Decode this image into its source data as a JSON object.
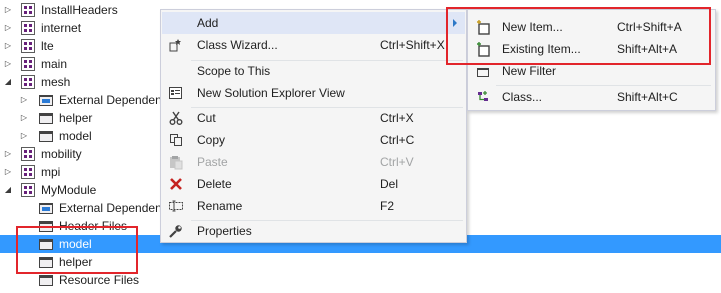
{
  "tree": {
    "items": [
      {
        "label": "InstallHeaders",
        "icon": "module-icon",
        "expander": "collapsed"
      },
      {
        "label": "internet",
        "icon": "module-icon",
        "expander": "collapsed"
      },
      {
        "label": "lte",
        "icon": "module-icon",
        "expander": "collapsed"
      },
      {
        "label": "main",
        "icon": "module-icon",
        "expander": "collapsed"
      },
      {
        "label": "mesh",
        "icon": "module-icon",
        "expander": "expanded"
      },
      {
        "label": "External Dependencies",
        "icon": "external-dependencies-icon",
        "expander": "collapsed"
      },
      {
        "label": "helper",
        "icon": "folder-filter-icon",
        "expander": "collapsed"
      },
      {
        "label": "model",
        "icon": "folder-filter-icon",
        "expander": "collapsed"
      },
      {
        "label": "mobility",
        "icon": "module-icon",
        "expander": "collapsed"
      },
      {
        "label": "mpi",
        "icon": "module-icon",
        "expander": "collapsed"
      },
      {
        "label": "MyModule",
        "icon": "module-icon",
        "expander": "expanded"
      },
      {
        "label": "External Dependencies",
        "icon": "external-dependencies-icon",
        "expander": "none"
      },
      {
        "label": "Header Files",
        "icon": "folder-filter-icon",
        "expander": "none"
      },
      {
        "label": "model",
        "icon": "folder-filter-icon",
        "expander": "none",
        "selected": true
      },
      {
        "label": "helper",
        "icon": "folder-filter-icon",
        "expander": "none"
      },
      {
        "label": "Resource Files",
        "icon": "folder-filter-icon",
        "expander": "none"
      }
    ]
  },
  "context_menu": {
    "items": [
      {
        "label": "Add",
        "shortcut": "",
        "icon": "",
        "has_submenu": true,
        "hover": true
      },
      {
        "label": "Class Wizard...",
        "shortcut": "Ctrl+Shift+X",
        "icon": "class-wizard-icon"
      },
      {
        "label": "Scope to This",
        "shortcut": "",
        "icon": ""
      },
      {
        "label": "New Solution Explorer View",
        "shortcut": "",
        "icon": "new-explorer-view-icon"
      },
      {
        "label": "Cut",
        "shortcut": "Ctrl+X",
        "icon": "cut-icon"
      },
      {
        "label": "Copy",
        "shortcut": "Ctrl+C",
        "icon": "copy-icon"
      },
      {
        "label": "Paste",
        "shortcut": "Ctrl+V",
        "icon": "paste-icon",
        "disabled": true
      },
      {
        "label": "Delete",
        "shortcut": "Del",
        "icon": "delete-icon"
      },
      {
        "label": "Rename",
        "shortcut": "F2",
        "icon": "rename-icon"
      },
      {
        "label": "Properties",
        "shortcut": "",
        "icon": "properties-icon"
      }
    ]
  },
  "add_submenu": {
    "items": [
      {
        "label": "New Item...",
        "shortcut": "Ctrl+Shift+A",
        "icon": "new-item-icon"
      },
      {
        "label": "Existing Item...",
        "shortcut": "Shift+Alt+A",
        "icon": "existing-item-icon"
      },
      {
        "label": "New Filter",
        "shortcut": "",
        "icon": "new-filter-icon"
      },
      {
        "label": "Class...",
        "shortcut": "Shift+Alt+C",
        "icon": "class-icon"
      }
    ]
  },
  "colors": {
    "selection": "#3399ff",
    "menu_background": "#f5f5f5",
    "menu_hover": "#dfe6f6",
    "highlight_box": "#e2252b"
  }
}
